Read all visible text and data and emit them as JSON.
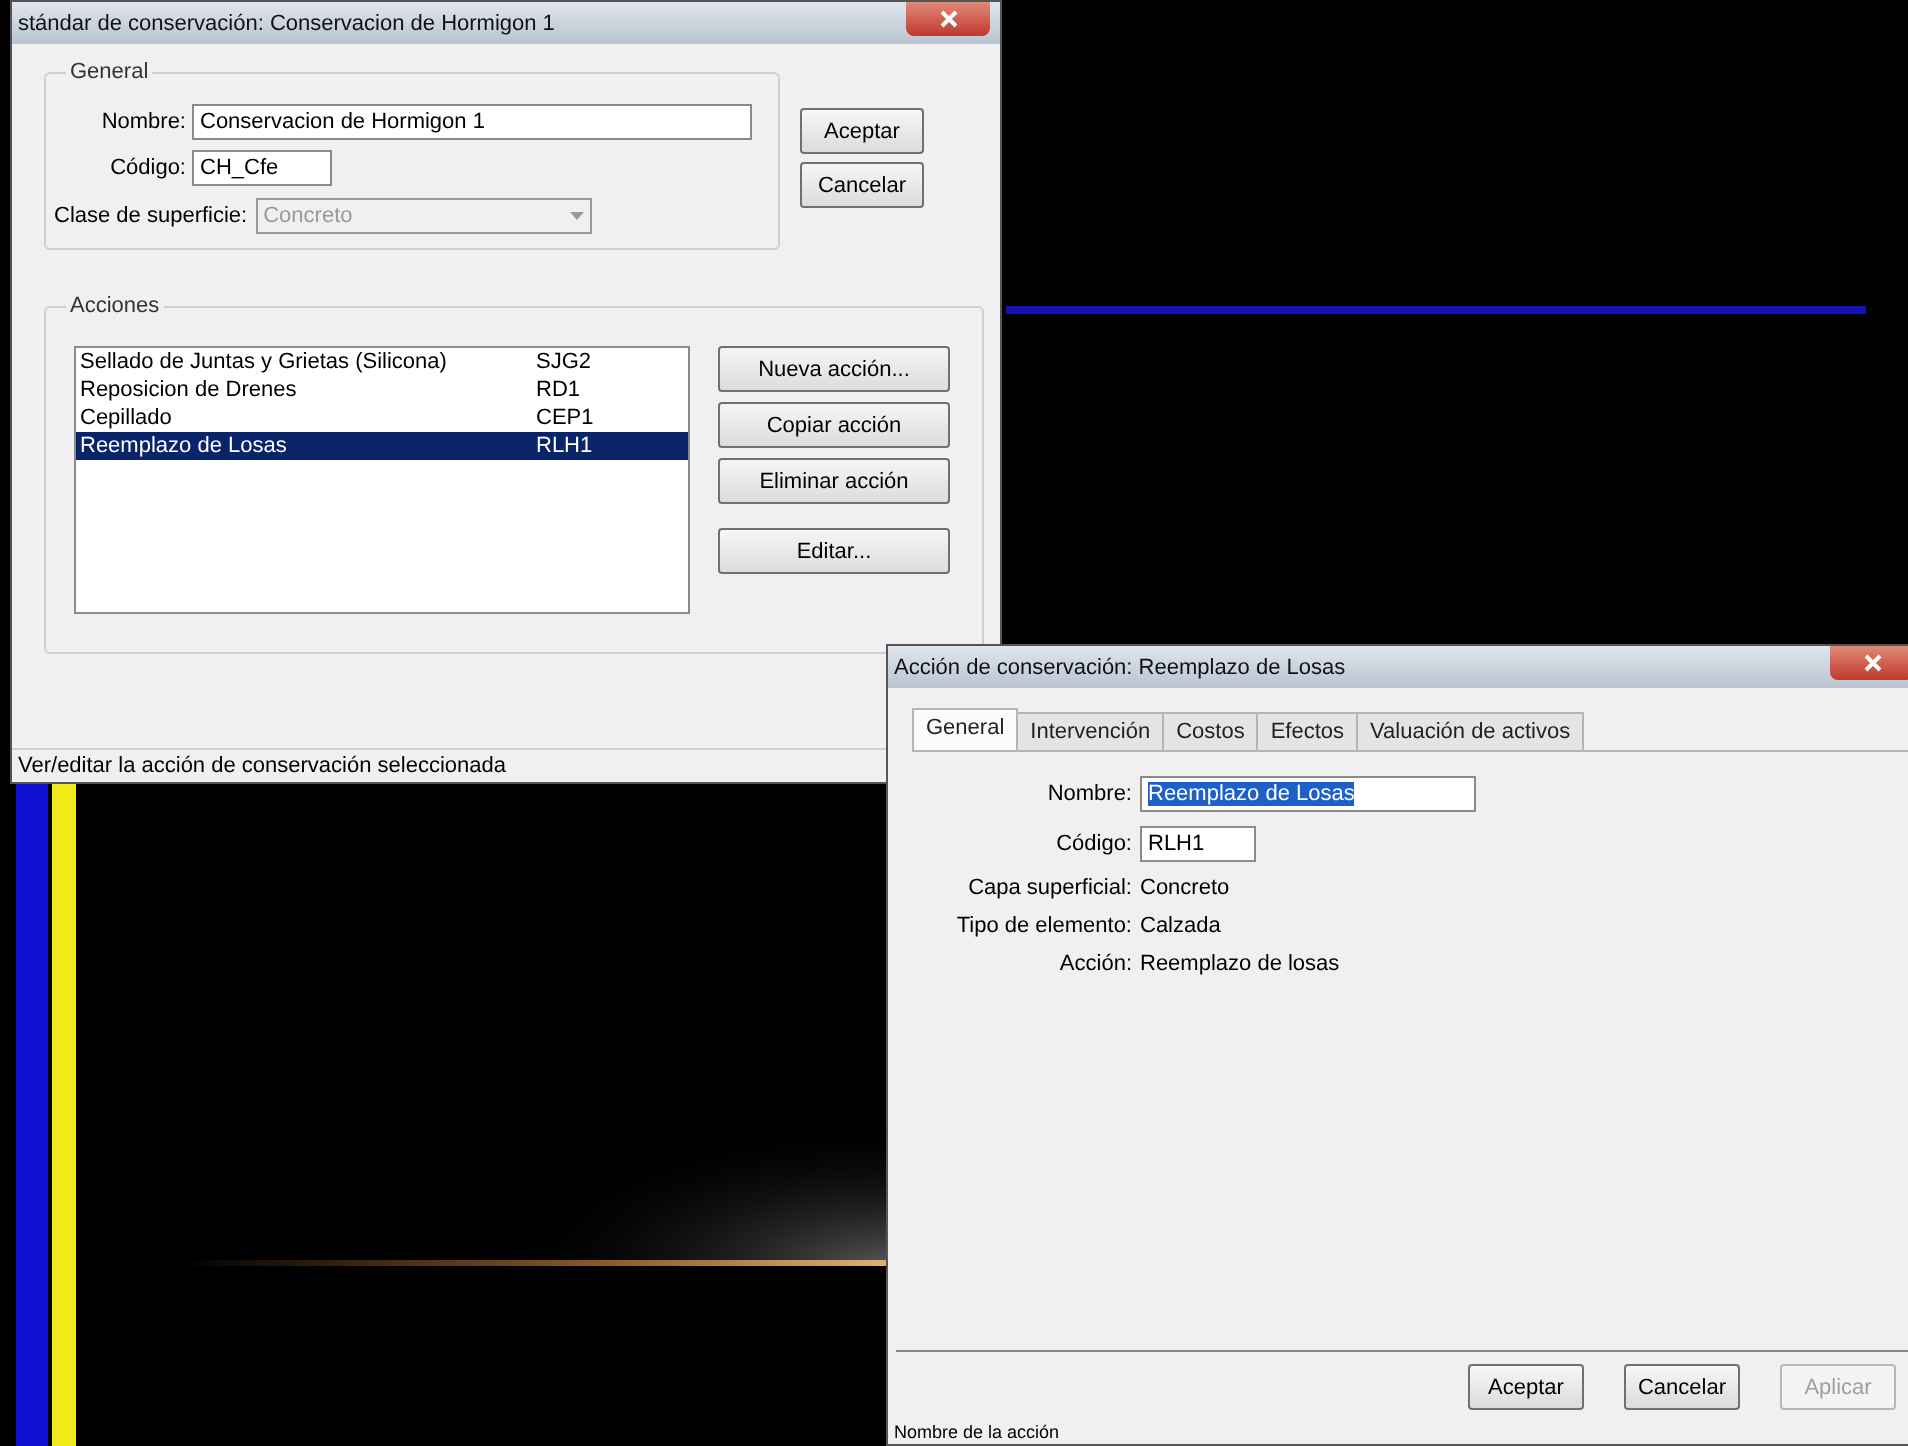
{
  "standard_dialog": {
    "title": "stándar de conservación: Conservacion de Hormigon 1",
    "general": {
      "legend": "General",
      "fields": [
        {
          "label": "Nombre:",
          "value": "Conservacion de Hormigon 1"
        },
        {
          "label": "Código:",
          "value": "CH_Cfe"
        }
      ],
      "surface": {
        "label": "Clase de superficie:",
        "value": "Concreto",
        "disabled": true
      }
    },
    "buttons": [
      {
        "label": "Aceptar"
      },
      {
        "label": "Cancelar"
      }
    ],
    "actions": {
      "legend": "Acciones",
      "rows": [
        {
          "name": "Sellado de Juntas y Grietas (Silicona)",
          "code": "SJG2",
          "selected": false
        },
        {
          "name": "Reposicion de Drenes",
          "code": "RD1",
          "selected": false
        },
        {
          "name": "Cepillado",
          "code": "CEP1",
          "selected": false
        },
        {
          "name": "Reemplazo de Losas",
          "code": "RLH1",
          "selected": true
        }
      ],
      "buttons": [
        {
          "label": "Nueva acción..."
        },
        {
          "label": "Copiar acción"
        },
        {
          "label": "Eliminar acción"
        },
        {
          "label": "Editar..."
        }
      ]
    },
    "status_bar": "Ver/editar la acción de conservación seleccionada"
  },
  "action_dialog": {
    "title": "Acción de conservación: Reemplazo de Losas",
    "tabs": [
      {
        "label": "General",
        "selected": true
      },
      {
        "label": "Intervención",
        "selected": false
      },
      {
        "label": "Costos",
        "selected": false
      },
      {
        "label": "Efectos",
        "selected": false
      },
      {
        "label": "Valuación de activos",
        "selected": false
      }
    ],
    "fields": [
      {
        "kind": "input",
        "label": "Nombre:",
        "value": "Reemplazo de Losas",
        "highlighted": true
      },
      {
        "kind": "input",
        "label": "Código:",
        "value": "RLH1",
        "highlighted": false
      },
      {
        "kind": "text",
        "label": "Capa superficial:",
        "value": "Concreto"
      },
      {
        "kind": "text",
        "label": "Tipo de elemento:",
        "value": "Calzada"
      },
      {
        "kind": "text",
        "label": "Acción:",
        "value": "Reemplazo de losas"
      }
    ],
    "buttons": [
      {
        "label": "Aceptar",
        "disabled": false
      },
      {
        "label": "Cancelar",
        "disabled": false
      },
      {
        "label": "Aplicar",
        "disabled": true
      }
    ],
    "status_bar": "Nombre de la acción"
  }
}
